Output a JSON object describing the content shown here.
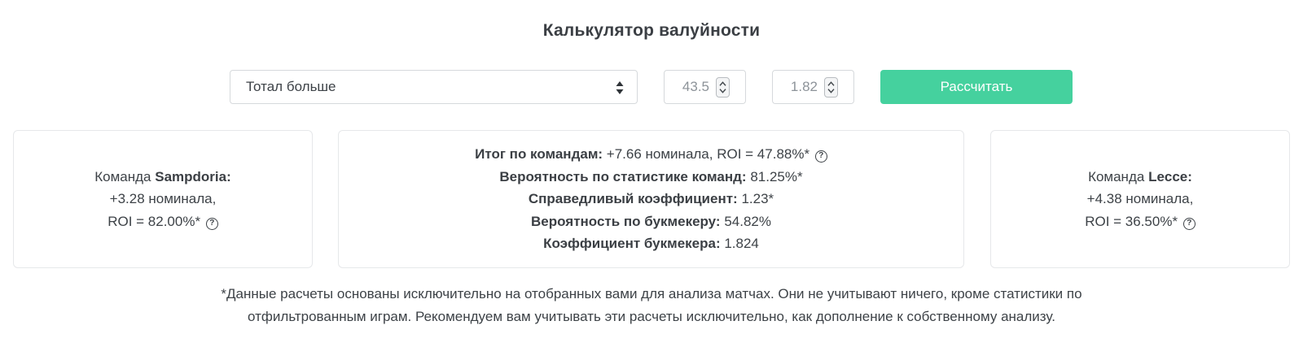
{
  "page_title": "Калькулятор валуйности",
  "controls": {
    "bet_type_selected": "Тотал больше",
    "total_value": "43.5",
    "odds_value": "1.82",
    "calculate_label": "Рассчитать"
  },
  "team_left": {
    "prefix": "Команда ",
    "name": "Sampdoria:",
    "nominal": "+3.28 номинала,",
    "roi": "ROI = 82.00%*"
  },
  "summary": {
    "rows": [
      {
        "label": "Итог по командам:",
        "value": " +7.66 номинала, ROI = 47.88%*"
      },
      {
        "label": "Вероятность по статистике команд:",
        "value": " 81.25%*"
      },
      {
        "label": "Справедливый коэффициент:",
        "value": " 1.23*"
      },
      {
        "label": "Вероятность по букмекеру:",
        "value": " 54.82%"
      },
      {
        "label": "Коэффициент букмекера:",
        "value": " 1.824"
      }
    ]
  },
  "team_right": {
    "prefix": "Команда ",
    "name": "Lecce:",
    "nominal": "+4.38 номинала,",
    "roi": "ROI = 36.50%*"
  },
  "footnote": {
    "line1": "*Данные расчеты основаны исключительно на отобранных вами для анализа матчах. Они не учитывают ничего, кроме статистики по",
    "line2": "отфильтрованным играм. Рекомендуем вам учитывать эти расчеты исключительно, как дополнение к собственному анализу."
  },
  "icons": {
    "help": "help-circle-icon",
    "select_arrows": "sort-arrows-icon",
    "spinner": "spinner-icon"
  },
  "colors": {
    "accent": "#45d19e",
    "text": "#3d4247",
    "border": "#d6d9dc"
  }
}
